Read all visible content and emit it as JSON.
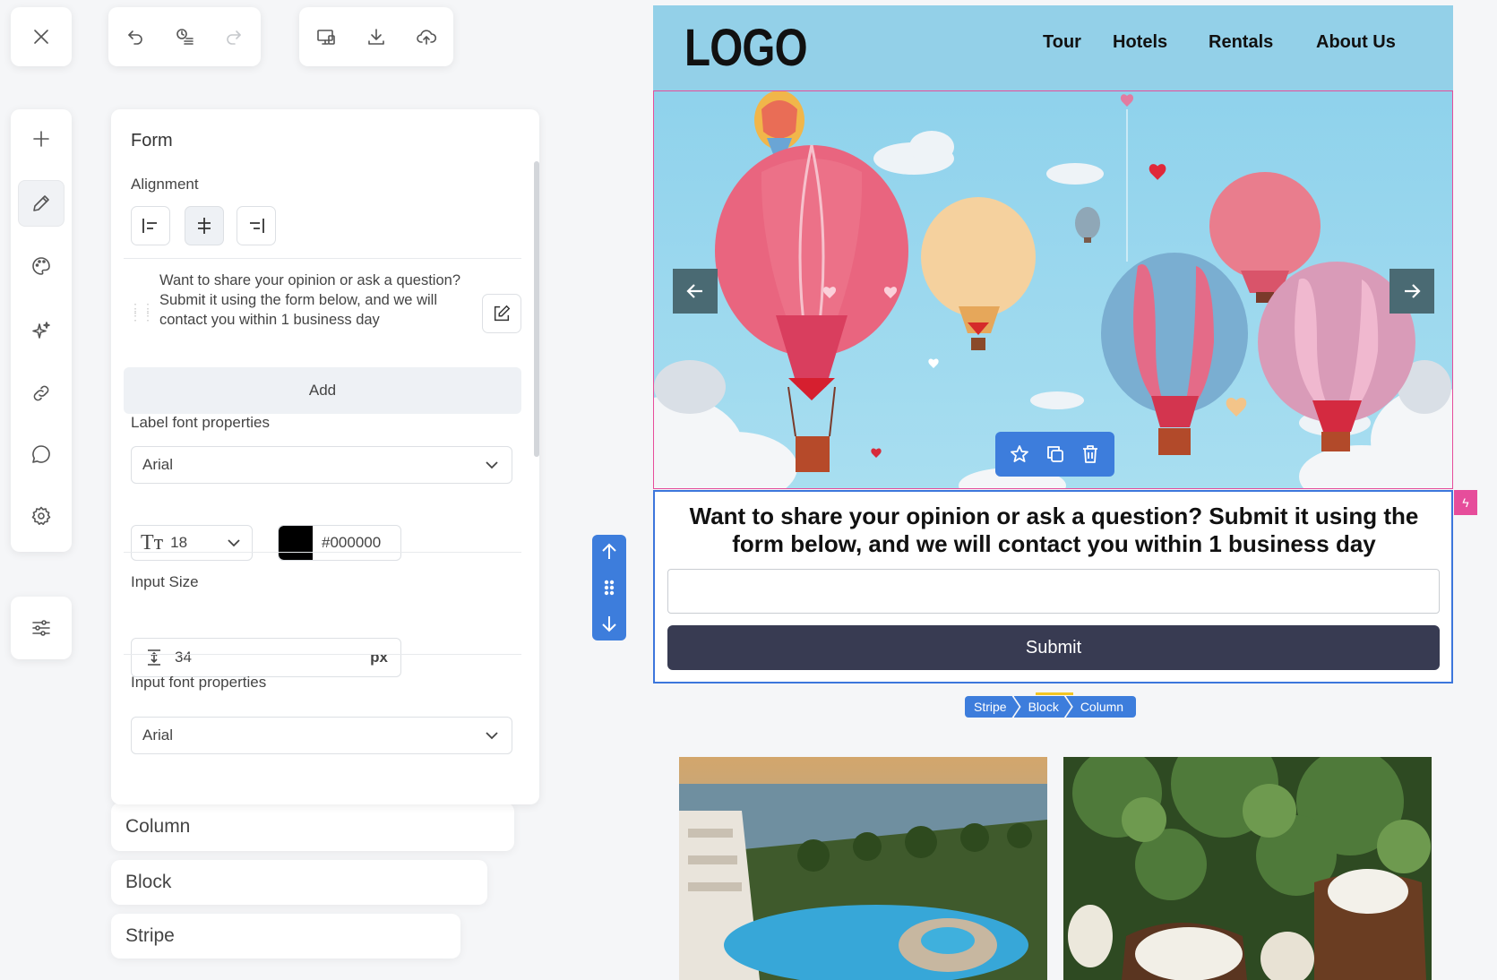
{
  "top_toolbar": {
    "close_icon": "close-icon",
    "undo_icon": "undo-icon",
    "history_icon": "history-icon",
    "redo_icon": "redo-icon",
    "preview_icon": "device-preview-icon",
    "download_icon": "download-icon",
    "upload_icon": "cloud-upload-icon"
  },
  "side_nav": {
    "items": [
      "add-icon",
      "pencil-icon",
      "palette-icon",
      "sparkle-icon",
      "link-icon",
      "comment-icon",
      "gear-icon"
    ],
    "settings_icon": "sliders-icon"
  },
  "panel": {
    "title": "Form",
    "alignment_label": "Alignment",
    "field_text": "Want to share your opinion or ask a question? Submit it using the form below, and we will contact you within 1 business day",
    "add_label": "Add",
    "label_font_label": "Label font properties",
    "label_font": "Arial",
    "label_font_size": "18",
    "label_color_hex": "#000000",
    "input_size_label": "Input Size",
    "input_size_value": "34",
    "input_size_unit": "px",
    "input_font_label": "Input font properties",
    "input_font": "Arial"
  },
  "layers": {
    "column": "Column",
    "block": "Block",
    "stripe": "Stripe"
  },
  "preview": {
    "logo": "LOGO",
    "nav": [
      "Tour",
      "Hotels",
      "Rentals",
      "About Us"
    ],
    "form_text": "Want to share your opinion or ask a question? Submit it using the form below, and we will contact you within 1 business day",
    "submit_label": "Submit",
    "breadcrumbs": [
      "Stripe",
      "Block",
      "Column"
    ]
  },
  "colors": {
    "accent": "#3d7ddc",
    "header_bg": "#93d0e8",
    "submit_bg": "#383b52",
    "selection_pink": "#e64d9b"
  }
}
